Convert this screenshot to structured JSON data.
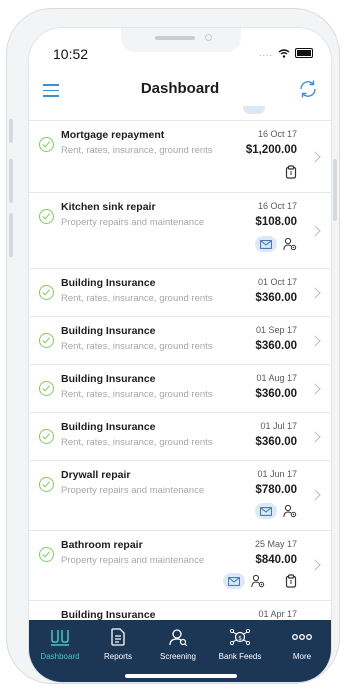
{
  "status_bar": {
    "time": "10:52",
    "signal": "...."
  },
  "header": {
    "title": "Dashboard"
  },
  "transactions": [
    {
      "title": "Mortgage repayment",
      "category": "Rent, rates, insurance, ground rents",
      "date": "16 Oct 17",
      "amount": "$1,200.00",
      "icons": [
        "clipboard-icon"
      ]
    },
    {
      "title": "Kitchen sink repair",
      "category": "Property repairs and maintenance",
      "date": "16 Oct 17",
      "amount": "$108.00",
      "icons": [
        "envelope-icon",
        "contractor-icon"
      ]
    },
    {
      "title": "Building Insurance",
      "category": "Rent, rates, insurance, ground rents",
      "date": "01 Oct 17",
      "amount": "$360.00",
      "icons": []
    },
    {
      "title": "Building Insurance",
      "category": "Rent, rates, insurance, ground rents",
      "date": "01 Sep 17",
      "amount": "$360.00",
      "icons": []
    },
    {
      "title": "Building Insurance",
      "category": "Rent, rates, insurance, ground rents",
      "date": "01 Aug 17",
      "amount": "$360.00",
      "icons": []
    },
    {
      "title": "Building Insurance",
      "category": "Rent, rates, insurance, ground rents",
      "date": "01 Jul 17",
      "amount": "$360.00",
      "icons": []
    },
    {
      "title": "Drywall repair",
      "category": "Property repairs and maintenance",
      "date": "01 Jun 17",
      "amount": "$780.00",
      "icons": [
        "envelope-icon",
        "contractor-icon"
      ]
    },
    {
      "title": "Bathroom repair",
      "category": "Property repairs and maintenance",
      "date": "25 May 17",
      "amount": "$840.00",
      "icons": [
        "envelope-icon",
        "contractor-icon",
        "clipboard-icon"
      ]
    },
    {
      "title": "Building Insurance",
      "category": "",
      "date": "01 Apr 17",
      "amount": "",
      "icons": []
    }
  ],
  "tabbar": {
    "items": [
      {
        "label": "Dashboard",
        "icon": "dashboard-icon",
        "active": true
      },
      {
        "label": "Reports",
        "icon": "reports-icon",
        "active": false
      },
      {
        "label": "Screening",
        "icon": "screening-icon",
        "active": false
      },
      {
        "label": "Bank Feeds",
        "icon": "bank-feeds-icon",
        "active": false
      },
      {
        "label": "More",
        "icon": "more-icon",
        "active": false
      }
    ]
  },
  "colors": {
    "accent": "#45c7c4",
    "tabbar_bg": "#1c3656",
    "check": "#7ccd5c",
    "link": "#3b8fd8"
  }
}
